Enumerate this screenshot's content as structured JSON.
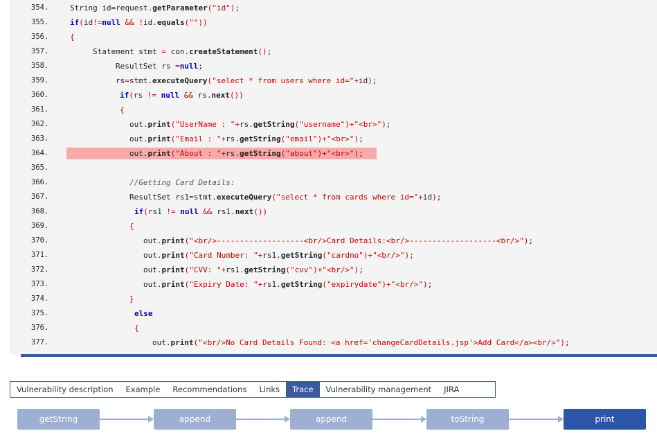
{
  "code": {
    "lines": [
      {
        "num": "354.",
        "indent": 101,
        "highlight": false,
        "tokens": [
          [
            "n",
            "String id=request."
          ],
          [
            "m",
            "getParameter"
          ],
          [
            "s",
            "(\"id\")"
          ],
          [
            "n",
            ";"
          ]
        ]
      },
      {
        "num": "355.",
        "indent": 101,
        "highlight": false,
        "tokens": [
          [
            "k",
            "if"
          ],
          [
            "o",
            "("
          ],
          [
            "n",
            "id"
          ],
          [
            "o",
            "!="
          ],
          [
            "k",
            "null"
          ],
          [
            "n",
            " "
          ],
          [
            "o",
            "&&"
          ],
          [
            "n",
            " "
          ],
          [
            "o",
            "!"
          ],
          [
            "n",
            "id."
          ],
          [
            "m",
            "equals"
          ],
          [
            "s",
            "(\"\"))"
          ]
        ]
      },
      {
        "num": "356.",
        "indent": 101,
        "highlight": false,
        "tokens": [
          [
            "o",
            "{"
          ]
        ]
      },
      {
        "num": "357.",
        "indent": 134,
        "highlight": false,
        "tokens": [
          [
            "n",
            "Statement stmt "
          ],
          [
            "o",
            "="
          ],
          [
            "n",
            " con."
          ],
          [
            "m",
            "createStatement"
          ],
          [
            "o",
            "()"
          ],
          [
            "n",
            ";"
          ]
        ]
      },
      {
        "num": "358.",
        "indent": 167,
        "highlight": false,
        "tokens": [
          [
            "n",
            "ResultSet rs "
          ],
          [
            "o",
            "="
          ],
          [
            "k",
            "null"
          ],
          [
            "n",
            ";"
          ]
        ]
      },
      {
        "num": "359.",
        "indent": 167,
        "highlight": false,
        "tokens": [
          [
            "n",
            "rs"
          ],
          [
            "o",
            "="
          ],
          [
            "n",
            "stmt."
          ],
          [
            "m",
            "executeQuery"
          ],
          [
            "s",
            "(\"select * from users where id=\"+"
          ],
          [
            "n",
            "id"
          ],
          [
            "s",
            ")"
          ],
          [
            "n",
            ";"
          ]
        ]
      },
      {
        "num": "360.",
        "indent": 173,
        "highlight": false,
        "tokens": [
          [
            "k",
            "if"
          ],
          [
            "o",
            "("
          ],
          [
            "n",
            "rs "
          ],
          [
            "o",
            "!="
          ],
          [
            "n",
            " "
          ],
          [
            "k",
            "null"
          ],
          [
            "n",
            " "
          ],
          [
            "o",
            "&&"
          ],
          [
            "n",
            " rs."
          ],
          [
            "m",
            "next"
          ],
          [
            "o",
            "())"
          ]
        ]
      },
      {
        "num": "361.",
        "indent": 173,
        "highlight": false,
        "tokens": [
          [
            "o",
            "{"
          ]
        ]
      },
      {
        "num": "362.",
        "indent": 187,
        "highlight": false,
        "tokens": [
          [
            "n",
            "out."
          ],
          [
            "m",
            "print"
          ],
          [
            "s",
            "(\"UserName : \"+"
          ],
          [
            "n",
            "rs."
          ],
          [
            "m",
            "getString"
          ],
          [
            "s",
            "(\"username\")+\"<br>\")"
          ],
          [
            "n",
            ";"
          ]
        ]
      },
      {
        "num": "363.",
        "indent": 187,
        "highlight": false,
        "tokens": [
          [
            "n",
            "out."
          ],
          [
            "m",
            "print"
          ],
          [
            "s",
            "(\"Email : \"+"
          ],
          [
            "n",
            "rs."
          ],
          [
            "m",
            "getString"
          ],
          [
            "s",
            "(\"email\")+\"<br>\")"
          ],
          [
            "n",
            ";"
          ]
        ]
      },
      {
        "num": "364.",
        "indent": 187,
        "highlight": true,
        "tokens": [
          [
            "n",
            "out."
          ],
          [
            "m",
            "print"
          ],
          [
            "s",
            "(\"About : \"+"
          ],
          [
            "n",
            "rs."
          ],
          [
            "m",
            "getString"
          ],
          [
            "s",
            "(\"about\")+\"<br>\")"
          ],
          [
            "n",
            ";"
          ]
        ]
      },
      {
        "num": "365.",
        "indent": 187,
        "highlight": false,
        "tokens": []
      },
      {
        "num": "366.",
        "indent": 187,
        "highlight": false,
        "tokens": [
          [
            "c",
            "//Getting Card Details:"
          ]
        ]
      },
      {
        "num": "367.",
        "indent": 187,
        "highlight": false,
        "tokens": [
          [
            "n",
            "ResultSet rs1"
          ],
          [
            "o",
            "="
          ],
          [
            "n",
            "stmt."
          ],
          [
            "m",
            "executeQuery"
          ],
          [
            "s",
            "(\"select * from cards where id=\"+"
          ],
          [
            "n",
            "id"
          ],
          [
            "s",
            ")"
          ],
          [
            "n",
            ";"
          ]
        ]
      },
      {
        "num": "368.",
        "indent": 194,
        "highlight": false,
        "tokens": [
          [
            "k",
            "if"
          ],
          [
            "o",
            "("
          ],
          [
            "n",
            "rs1 "
          ],
          [
            "o",
            "!="
          ],
          [
            "n",
            " "
          ],
          [
            "k",
            "null"
          ],
          [
            "n",
            " "
          ],
          [
            "o",
            "&&"
          ],
          [
            "n",
            " rs1."
          ],
          [
            "m",
            "next"
          ],
          [
            "o",
            "())"
          ]
        ]
      },
      {
        "num": "369.",
        "indent": 187,
        "highlight": false,
        "tokens": [
          [
            "o",
            "{"
          ]
        ]
      },
      {
        "num": "370.",
        "indent": 207,
        "highlight": false,
        "tokens": [
          [
            "n",
            "out."
          ],
          [
            "m",
            "print"
          ],
          [
            "s",
            "(\"<br/>-------------------<br/>Card Details:<br/>-------------------<br/>\")"
          ],
          [
            "n",
            ";"
          ]
        ]
      },
      {
        "num": "371.",
        "indent": 207,
        "highlight": false,
        "tokens": [
          [
            "n",
            "out."
          ],
          [
            "m",
            "print"
          ],
          [
            "s",
            "(\"Card Number: \"+"
          ],
          [
            "n",
            "rs1."
          ],
          [
            "m",
            "getString"
          ],
          [
            "s",
            "(\"cardno\")+\"<br/>\")"
          ],
          [
            "n",
            ";"
          ]
        ]
      },
      {
        "num": "372.",
        "indent": 207,
        "highlight": false,
        "tokens": [
          [
            "n",
            "out."
          ],
          [
            "m",
            "print"
          ],
          [
            "s",
            "(\"CVV: \"+"
          ],
          [
            "n",
            "rs1."
          ],
          [
            "m",
            "getString"
          ],
          [
            "s",
            "(\"cvv\")+\"<br/>\")"
          ],
          [
            "n",
            ";"
          ]
        ]
      },
      {
        "num": "373.",
        "indent": 207,
        "highlight": false,
        "tokens": [
          [
            "n",
            "out."
          ],
          [
            "m",
            "print"
          ],
          [
            "s",
            "(\"Expiry Date: \"+"
          ],
          [
            "n",
            "rs1."
          ],
          [
            "m",
            "getString"
          ],
          [
            "s",
            "(\"expirydate\")+\"<br/>\")"
          ],
          [
            "n",
            ";"
          ]
        ]
      },
      {
        "num": "374.",
        "indent": 187,
        "highlight": false,
        "tokens": [
          [
            "o",
            "}"
          ]
        ]
      },
      {
        "num": "375.",
        "indent": 194,
        "highlight": false,
        "tokens": [
          [
            "k",
            "else"
          ]
        ]
      },
      {
        "num": "376.",
        "indent": 194,
        "highlight": false,
        "tokens": [
          [
            "o",
            "{"
          ]
        ]
      },
      {
        "num": "377.",
        "indent": 220,
        "highlight": false,
        "tokens": [
          [
            "n",
            "out."
          ],
          [
            "m",
            "print"
          ],
          [
            "s",
            "(\"<br/>No Card Details Found: <a href='changeCardDetails.jsp'>Add Card</a><br/>\")"
          ],
          [
            "n",
            ";"
          ]
        ]
      }
    ]
  },
  "tabs": [
    {
      "label": "Vulnerability description",
      "active": false
    },
    {
      "label": "Example",
      "active": false
    },
    {
      "label": "Recommendations",
      "active": false
    },
    {
      "label": "Links",
      "active": false
    },
    {
      "label": "Trace",
      "active": true
    },
    {
      "label": "Vulnerability management",
      "active": false
    },
    {
      "label": "JIRA",
      "active": false
    }
  ],
  "trace": {
    "nodes": [
      "getString",
      "append",
      "append",
      "toString",
      "print"
    ],
    "colors": {
      "node": "#9dafd3",
      "last": "#2c54a8"
    }
  },
  "colors": {
    "keyword": "#0000bb",
    "string": "#cc0000",
    "highlight": "#f6aaaa",
    "accent": "#3c5aa0"
  }
}
